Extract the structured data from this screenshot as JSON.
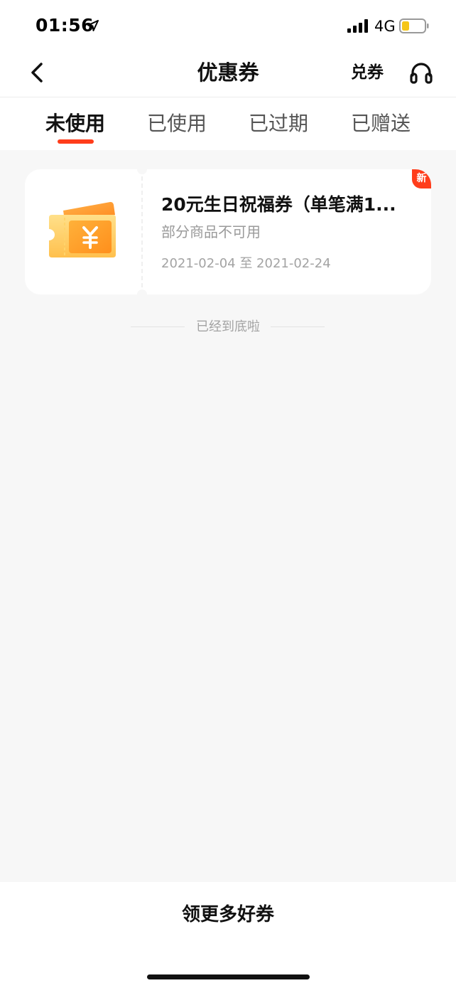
{
  "status_bar": {
    "time": "01:56",
    "network": "4G",
    "battery_color": "#f5c518"
  },
  "nav": {
    "title": "优惠券",
    "redeem_label": "兑券"
  },
  "tabs": [
    {
      "label": "未使用",
      "active": true
    },
    {
      "label": "已使用",
      "active": false
    },
    {
      "label": "已过期",
      "active": false
    },
    {
      "label": "已赠送",
      "active": false
    }
  ],
  "coupon": {
    "title": "20元生日祝福券（单笔满1...",
    "restriction": "部分商品不可用",
    "validity": "2021-02-04 至 2021-02-24",
    "badge": "新",
    "badge_color": "#ff3d1b",
    "icon": "ticket-yuan-icon"
  },
  "end_note": "已经到底啦",
  "bottom": {
    "button_label": "领更多好券"
  },
  "colors": {
    "accent": "#ff3d1b",
    "background": "#f7f7f7",
    "card": "#ffffff",
    "muted_text": "#9a9a9a"
  }
}
